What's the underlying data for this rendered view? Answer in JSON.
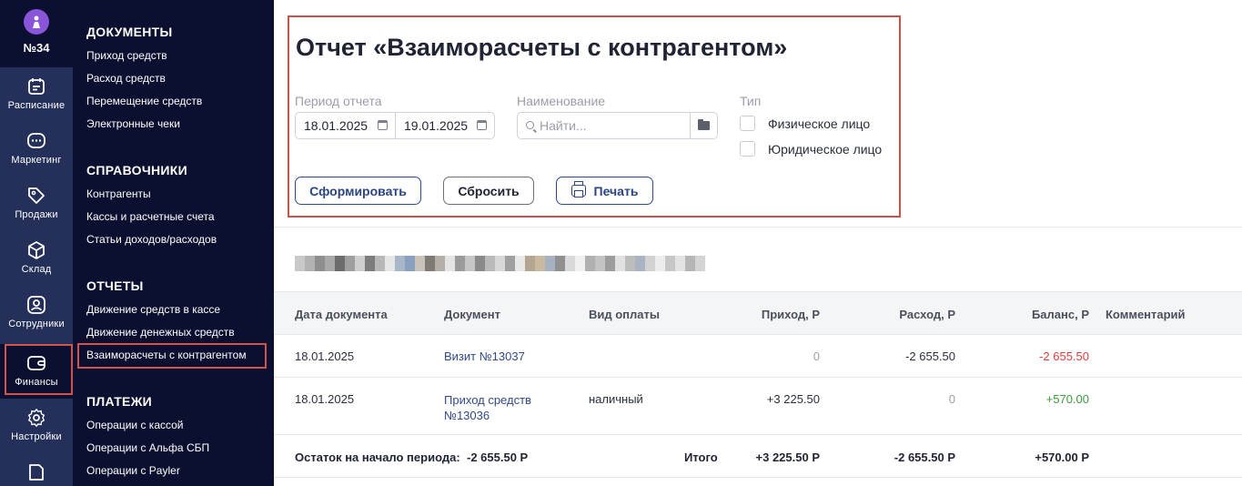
{
  "branch": "№34",
  "rail": [
    {
      "label": "Расписание",
      "icon": "calendar-icon"
    },
    {
      "label": "Маркетинг",
      "icon": "chat-icon"
    },
    {
      "label": "Продажи",
      "icon": "tag-icon"
    },
    {
      "label": "Склад",
      "icon": "box-icon"
    },
    {
      "label": "Сотрудники",
      "icon": "user-icon"
    },
    {
      "label": "Финансы",
      "icon": "wallet-icon"
    },
    {
      "label": "Настройки",
      "icon": "gear-icon"
    },
    {
      "label": "",
      "icon": "document-icon"
    }
  ],
  "submenu": {
    "documents": {
      "title": "ДОКУМЕНТЫ",
      "items": [
        "Приход средств",
        "Расход средств",
        "Перемещение средств",
        "Электронные чеки"
      ]
    },
    "references": {
      "title": "СПРАВОЧНИКИ",
      "items": [
        "Контрагенты",
        "Кассы и расчетные счета",
        "Статьи доходов/расходов"
      ]
    },
    "reports": {
      "title": "ОТЧЕТЫ",
      "items": [
        "Движение средств в кассе",
        "Движение денежных средств",
        "Взаиморасчеты с контрагентом"
      ]
    },
    "payments": {
      "title": "ПЛАТЕЖИ",
      "items": [
        "Операции с кассой",
        "Операции с Альфа СБП",
        "Операции с Payler"
      ]
    }
  },
  "report": {
    "title": "Отчет «Взаиморасчеты с контрагентом»",
    "period_label": "Период отчета",
    "date_from": "18.01.2025",
    "date_to": "19.01.2025",
    "name_label": "Наименование",
    "search_placeholder": "Найти...",
    "type_label": "Тип",
    "type_options": [
      "Физическое лицо",
      "Юридическое лицо"
    ],
    "buttons": {
      "generate": "Сформировать",
      "reset": "Сбросить",
      "print": "Печать"
    }
  },
  "table": {
    "columns": [
      "Дата документа",
      "Документ",
      "Вид оплаты",
      "Приход, Р",
      "Расход, Р",
      "Баланс, Р",
      "Комментарий"
    ],
    "rows": [
      {
        "date": "18.01.2025",
        "doc": "Визит №13037",
        "pay": "",
        "in": "0",
        "out": "-2 655.50",
        "balance": "-2 655.50",
        "comment": ""
      },
      {
        "date": "18.01.2025",
        "doc": "Приход средств №13036",
        "pay": "наличный",
        "in": "+3 225.50",
        "out": "0",
        "balance": "+570.00",
        "comment": ""
      }
    ],
    "footer": {
      "start_label": "Остаток на начало периода:",
      "start_value": "-2 655.50 Р",
      "total_label": "Итого",
      "total_in": "+3 225.50 Р",
      "total_out": "-2 655.50 Р",
      "total_balance": "+570.00 Р"
    }
  },
  "colors": {
    "sidebar": "#0b1030",
    "rail_nav": "#25305a",
    "accent": "#2a4580",
    "highlight": "#c8524a",
    "negative": "#e23a3a",
    "positive": "#3a9a3a"
  }
}
